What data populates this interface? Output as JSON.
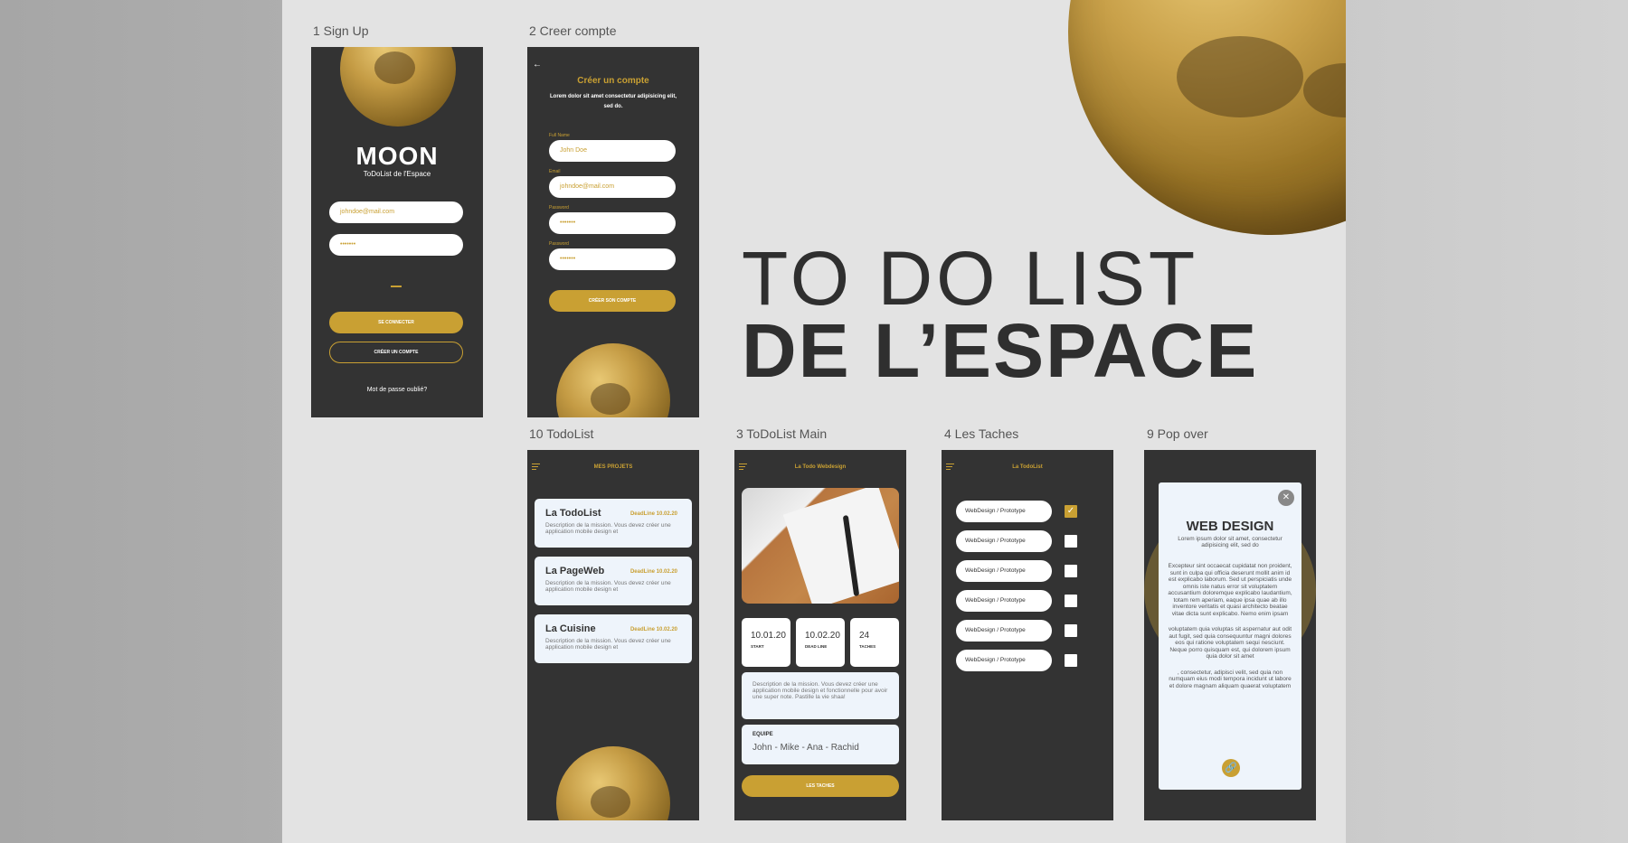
{
  "headline": {
    "line1": "TO DO LIST",
    "line2": "DE L’ESPACE"
  },
  "artboards": {
    "signup": {
      "label": "1 Sign Up",
      "logo": "MOON",
      "tagline": "ToDoList de l'Espace",
      "email_placeholder": "johndoe@mail.com",
      "password_value": "•••••••",
      "login_button": "SE CONNECTER",
      "create_button": "CRÉER UN COMPTE",
      "forgot": "Mot de passe oublié?"
    },
    "create": {
      "label": "2 Creer compte",
      "title": "Créer un compte",
      "subtitle": "Lorem dolor sit amet consectetur adipisicing elit, sed do.",
      "fullname_label": "Full Name",
      "fullname_value": "John Doe",
      "email_label": "Email",
      "email_value": "johndoe@mail.com",
      "password_label": "Password",
      "password_value": "•••••••",
      "password2_label": "Password",
      "password2_value": "•••••••",
      "submit": "CRÉER SON COMPTE"
    },
    "todolist": {
      "label": "10 TodoList",
      "header": "MES PROJETS",
      "projects": [
        {
          "title": "La TodoList",
          "deadline": "DeadLine 10.02.20",
          "desc": "Description de la mission. Vous devez créer une application mobile design et"
        },
        {
          "title": "La PageWeb",
          "deadline": "DeadLine 10.02.20",
          "desc": "Description de la mission. Vous devez créer une application mobile design et"
        },
        {
          "title": "La Cuisine",
          "deadline": "DeadLine 10.02.20",
          "desc": "Description de la mission. Vous devez créer une application mobile design et"
        }
      ]
    },
    "main": {
      "label": "3 ToDoList Main",
      "header": "La Todo Webdesign",
      "stats": [
        {
          "value": "10.01.20",
          "key": "START"
        },
        {
          "value": "10.02.20",
          "key": "DEAD LINE"
        },
        {
          "value": "24",
          "key": "TACHES"
        }
      ],
      "description": "Description de la mission. Vous devez créer une application mobile design et fonctionnelle pour avoir une super note. Pastille la vie shaa!",
      "team_label": "EQUIPE",
      "team_value": "John - Mike - Ana - Rachid",
      "tasks_button": "LES TACHES"
    },
    "tasks": {
      "label": "4 Les Taches",
      "header": "La TodoList",
      "items": [
        {
          "text": "WebDesign / Prototype",
          "done": true
        },
        {
          "text": "WebDesign / Prototype",
          "done": false
        },
        {
          "text": "WebDesign / Prototype",
          "done": false
        },
        {
          "text": "WebDesign / Prototype",
          "done": false
        },
        {
          "text": "WebDesign / Prototype",
          "done": false
        },
        {
          "text": "WebDesign / Prototype",
          "done": false
        }
      ]
    },
    "popover": {
      "label": "9 Pop over",
      "title": "WEB DESIGN",
      "subtitle": "Lorem ipsum dolor sit amet, consectetur adipisicing elit, sed do",
      "p1": "Excepteur sint occaecat cupidatat non proident, sunt in culpa qui officia deserunt mollit anim id est explicabo laborum. Sed ut perspiciatis unde omnis iste natus error sit voluptatem accusantium doloremque explicabo laudantium, totam rem aperiam, eaque ipsa quae ab illo inventore veritatis et quasi architecto beatae vitae dicta sunt explicabo. Nemo enim ipsam",
      "p2": "voluptatem quia voluptas sit aspernatur aut odit aut fugit, sed quia consequuntur magni dolores eos qui ratione voluptatem sequi nesciunt. Neque porro quisquam est, qui dolorem ipsum quia dolor sit amet",
      "p3": ", consectetur, adipisci velit, sed quia non numquam eius modi tempora incidunt ut labore et dolore magnam aliquam quaerat voluptatem"
    }
  },
  "colors": {
    "gold": "#c9a033",
    "dark": "#333333",
    "card": "#eef4fb"
  }
}
